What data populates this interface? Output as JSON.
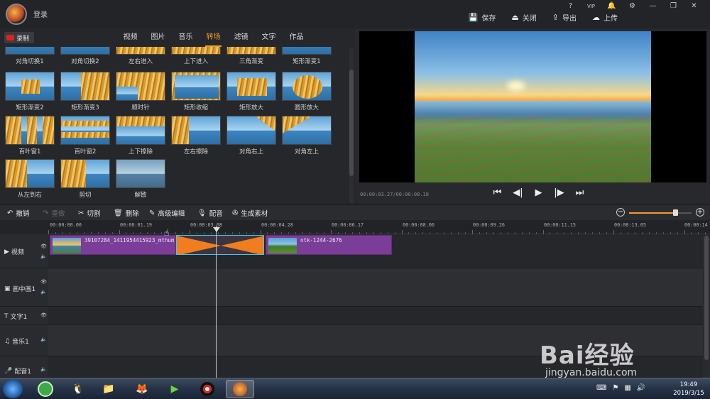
{
  "topbar": {
    "login_label": "登录",
    "window_icons": [
      "?",
      "VIP",
      "🔔",
      "⚙",
      "—",
      "❐",
      "✕"
    ],
    "actions": [
      {
        "icon": "save-icon",
        "glyph": "💾",
        "label": "保存"
      },
      {
        "icon": "close-icon",
        "glyph": "⏏",
        "label": "关闭"
      },
      {
        "icon": "export-icon",
        "glyph": "⇪",
        "label": "导出"
      },
      {
        "icon": "upload-icon",
        "glyph": "☁",
        "label": "上传"
      }
    ]
  },
  "record_button": {
    "label": "录制"
  },
  "tabs": [
    {
      "label": "视频"
    },
    {
      "label": "图片"
    },
    {
      "label": "音乐"
    },
    {
      "label": "转场",
      "active": true
    },
    {
      "label": "滤镜"
    },
    {
      "label": "文字"
    },
    {
      "label": "作品"
    }
  ],
  "transitions": [
    {
      "label": "对角切换1"
    },
    {
      "label": "对角切换2"
    },
    {
      "label": "左右进入"
    },
    {
      "label": "上下进入"
    },
    {
      "label": "三角渐变"
    },
    {
      "label": "矩形渐变1"
    },
    {
      "label": "矩形渐变2"
    },
    {
      "label": "矩形渐变3"
    },
    {
      "label": "顺时针"
    },
    {
      "label": "矩形收缩"
    },
    {
      "label": "矩形放大"
    },
    {
      "label": "圆形放大"
    },
    {
      "label": "百叶窗1"
    },
    {
      "label": "百叶窗2"
    },
    {
      "label": "上下擦除"
    },
    {
      "label": "左右擦除"
    },
    {
      "label": "对角右上"
    },
    {
      "label": "对角左上"
    },
    {
      "label": "从左到右"
    },
    {
      "label": "剪切"
    },
    {
      "label": "解散"
    }
  ],
  "preview": {
    "timecode": "00:00:03.27/00:00:08.18",
    "controls": [
      "skip-start-icon",
      "step-back-icon",
      "play-icon",
      "step-forward-icon",
      "skip-end-icon"
    ]
  },
  "edit_toolbar": {
    "undo": "撤销",
    "redo": "重做",
    "cut": "切割",
    "delete": "删除",
    "advanced": "高级编辑",
    "dub": "配音",
    "generate": "生成素材",
    "zoom_level": 0.73
  },
  "ruler": [
    "00:00:00.00",
    "00:00:01.19",
    "00:00:03.08",
    "00:00:04.28",
    "00:00:06.17",
    "00:00:08.06",
    "00:00:09.26",
    "00:00:11.15",
    "00:00:13.05",
    "00:00:14"
  ],
  "tracks": [
    {
      "label": "视频",
      "icon": "video-track-icon",
      "glyph": "▶"
    },
    {
      "label": "画中画1",
      "icon": "pip-track-icon",
      "glyph": "▣"
    },
    {
      "label": "文字1",
      "icon": "text-track-icon",
      "glyph": "T"
    },
    {
      "label": "音乐1",
      "icon": "music-track-icon",
      "glyph": "♫"
    },
    {
      "label": "配音1",
      "icon": "mic-track-icon",
      "glyph": "🎤"
    }
  ],
  "clips": {
    "clip1": "39107284_1411954415923_mthumb",
    "clip2": "ntk-1244-2676"
  },
  "taskbar": {
    "time": "19:49",
    "date": "2019/3/15"
  },
  "watermark": {
    "text": "Bai经验",
    "url": "jingyan.baidu.com"
  },
  "colors": {
    "accent": "#f29a2c",
    "clip": "#7a3d98",
    "record": "#e41f1f"
  }
}
